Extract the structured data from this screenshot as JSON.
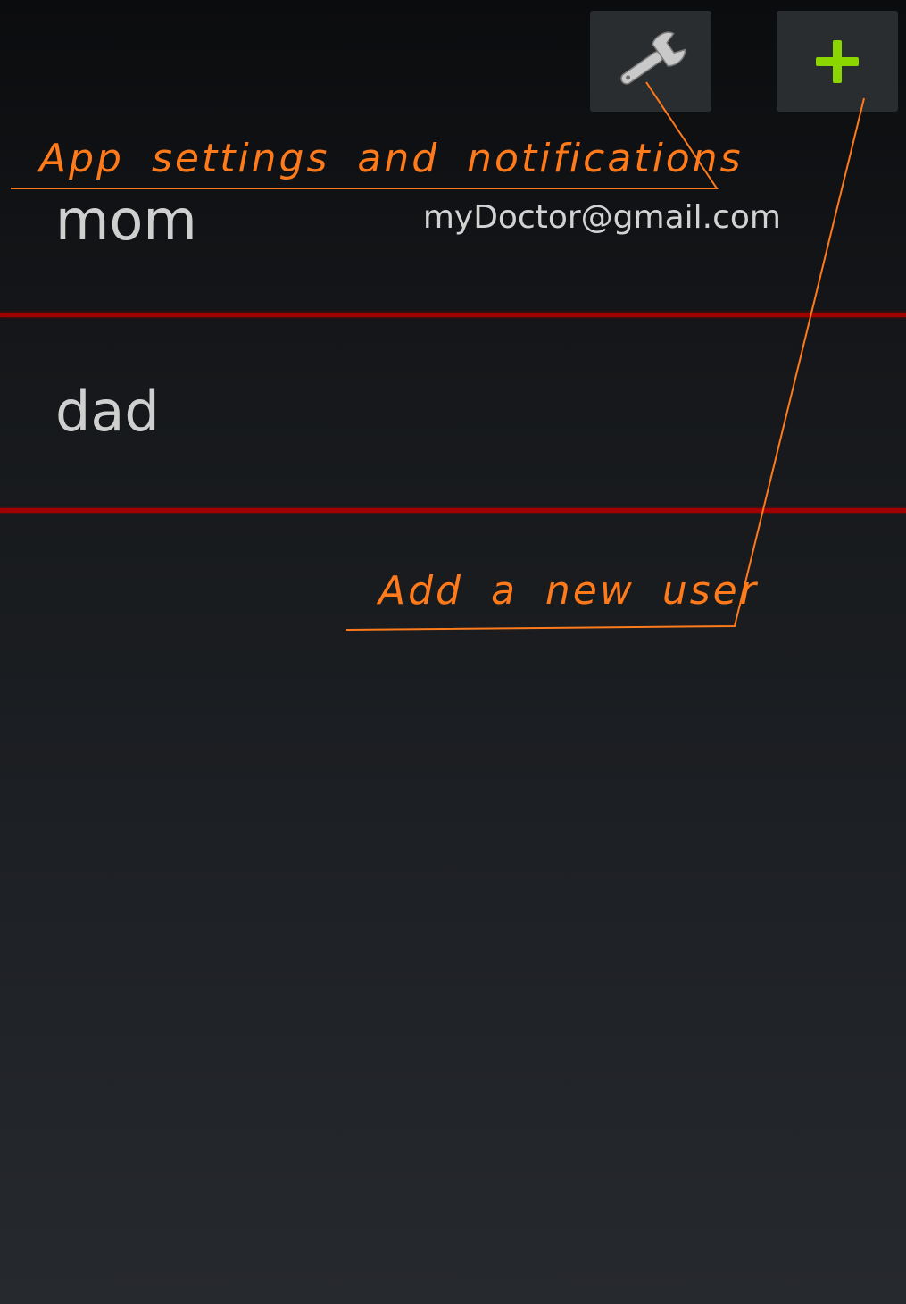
{
  "toolbar": {
    "settings_icon": "wrench-icon",
    "add_icon": "plus-icon",
    "add_icon_color": "#8bd600"
  },
  "users": [
    {
      "name": "mom",
      "email": "myDoctor@gmail.com"
    },
    {
      "name": "dad",
      "email": ""
    }
  ],
  "divider_color": "#a00000",
  "annotations": {
    "color": "#ff7a1a",
    "settings": "App settings and notifications",
    "add_user": "Add a new user"
  }
}
